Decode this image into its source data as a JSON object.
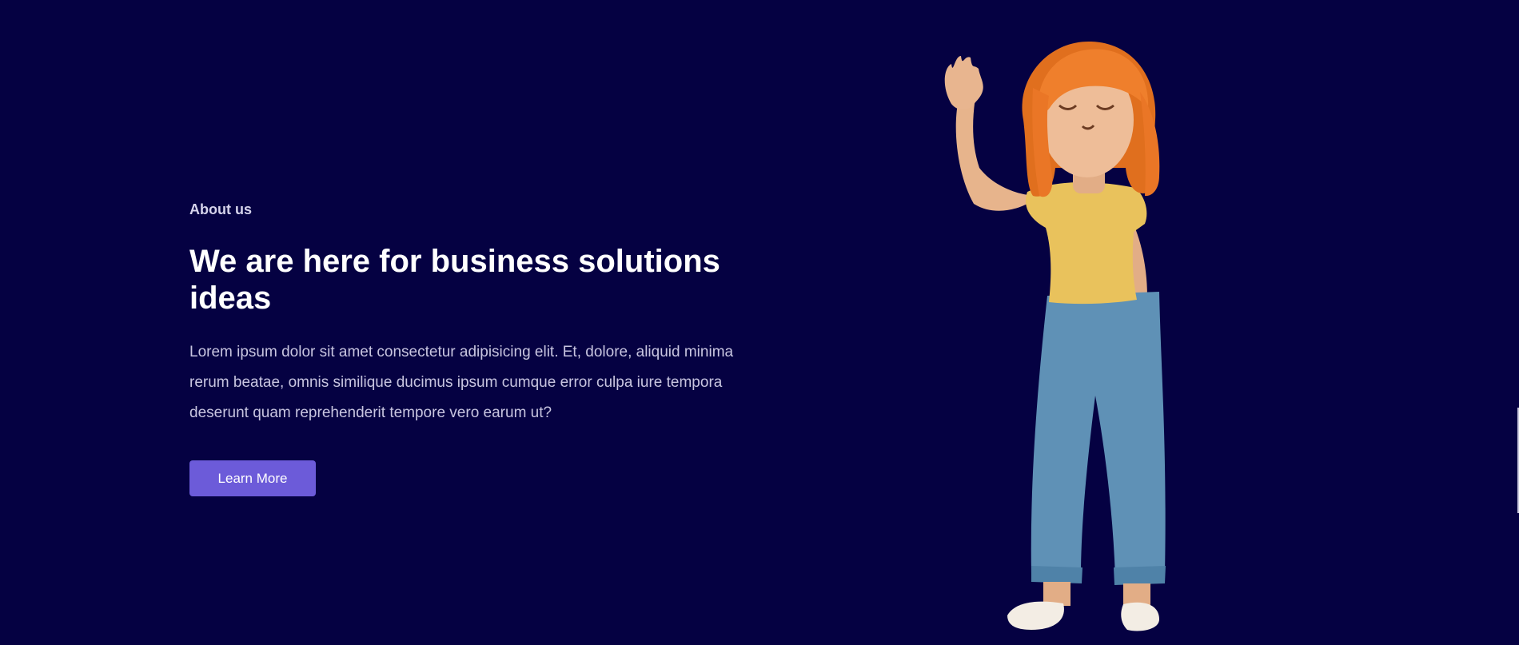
{
  "about": {
    "eyebrow": "About us",
    "title": "We are here for business solutions ideas",
    "description": "Lorem ipsum dolor sit amet consectetur adipisicing elit. Et, dolore, aliquid minima rerum beatae, omnis similique ducimus ipsum cumque error culpa iure tempora deserunt quam reprehenderit tempore vero earum ut?",
    "button_label": "Learn More"
  },
  "colors": {
    "background": "#050142",
    "accent": "#6c5bd9",
    "hair": "#ef7f2c",
    "shirt": "#e9c25c",
    "pants": "#5f91b6",
    "skin": "#e7b48c"
  },
  "illustration": {
    "icon": "waving-girl-illustration"
  }
}
